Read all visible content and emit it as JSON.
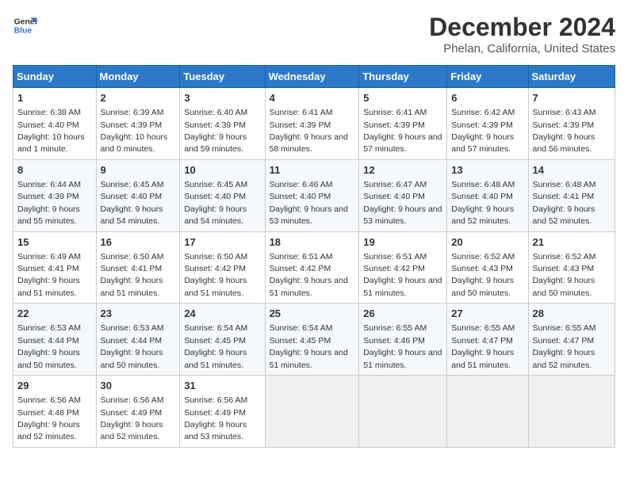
{
  "header": {
    "logo_line1": "General",
    "logo_line2": "Blue",
    "title": "December 2024",
    "subtitle": "Phelan, California, United States"
  },
  "weekdays": [
    "Sunday",
    "Monday",
    "Tuesday",
    "Wednesday",
    "Thursday",
    "Friday",
    "Saturday"
  ],
  "weeks": [
    [
      {
        "day": "1",
        "sunrise": "6:38 AM",
        "sunset": "4:40 PM",
        "daylight": "10 hours and 1 minute."
      },
      {
        "day": "2",
        "sunrise": "6:39 AM",
        "sunset": "4:39 PM",
        "daylight": "10 hours and 0 minutes."
      },
      {
        "day": "3",
        "sunrise": "6:40 AM",
        "sunset": "4:39 PM",
        "daylight": "9 hours and 59 minutes."
      },
      {
        "day": "4",
        "sunrise": "6:41 AM",
        "sunset": "4:39 PM",
        "daylight": "9 hours and 58 minutes."
      },
      {
        "day": "5",
        "sunrise": "6:41 AM",
        "sunset": "4:39 PM",
        "daylight": "9 hours and 57 minutes."
      },
      {
        "day": "6",
        "sunrise": "6:42 AM",
        "sunset": "4:39 PM",
        "daylight": "9 hours and 57 minutes."
      },
      {
        "day": "7",
        "sunrise": "6:43 AM",
        "sunset": "4:39 PM",
        "daylight": "9 hours and 56 minutes."
      }
    ],
    [
      {
        "day": "8",
        "sunrise": "6:44 AM",
        "sunset": "4:39 PM",
        "daylight": "9 hours and 55 minutes."
      },
      {
        "day": "9",
        "sunrise": "6:45 AM",
        "sunset": "4:40 PM",
        "daylight": "9 hours and 54 minutes."
      },
      {
        "day": "10",
        "sunrise": "6:45 AM",
        "sunset": "4:40 PM",
        "daylight": "9 hours and 54 minutes."
      },
      {
        "day": "11",
        "sunrise": "6:46 AM",
        "sunset": "4:40 PM",
        "daylight": "9 hours and 53 minutes."
      },
      {
        "day": "12",
        "sunrise": "6:47 AM",
        "sunset": "4:40 PM",
        "daylight": "9 hours and 53 minutes."
      },
      {
        "day": "13",
        "sunrise": "6:48 AM",
        "sunset": "4:40 PM",
        "daylight": "9 hours and 52 minutes."
      },
      {
        "day": "14",
        "sunrise": "6:48 AM",
        "sunset": "4:41 PM",
        "daylight": "9 hours and 52 minutes."
      }
    ],
    [
      {
        "day": "15",
        "sunrise": "6:49 AM",
        "sunset": "4:41 PM",
        "daylight": "9 hours and 51 minutes."
      },
      {
        "day": "16",
        "sunrise": "6:50 AM",
        "sunset": "4:41 PM",
        "daylight": "9 hours and 51 minutes."
      },
      {
        "day": "17",
        "sunrise": "6:50 AM",
        "sunset": "4:42 PM",
        "daylight": "9 hours and 51 minutes."
      },
      {
        "day": "18",
        "sunrise": "6:51 AM",
        "sunset": "4:42 PM",
        "daylight": "9 hours and 51 minutes."
      },
      {
        "day": "19",
        "sunrise": "6:51 AM",
        "sunset": "4:42 PM",
        "daylight": "9 hours and 51 minutes."
      },
      {
        "day": "20",
        "sunrise": "6:52 AM",
        "sunset": "4:43 PM",
        "daylight": "9 hours and 50 minutes."
      },
      {
        "day": "21",
        "sunrise": "6:52 AM",
        "sunset": "4:43 PM",
        "daylight": "9 hours and 50 minutes."
      }
    ],
    [
      {
        "day": "22",
        "sunrise": "6:53 AM",
        "sunset": "4:44 PM",
        "daylight": "9 hours and 50 minutes."
      },
      {
        "day": "23",
        "sunrise": "6:53 AM",
        "sunset": "4:44 PM",
        "daylight": "9 hours and 50 minutes."
      },
      {
        "day": "24",
        "sunrise": "6:54 AM",
        "sunset": "4:45 PM",
        "daylight": "9 hours and 51 minutes."
      },
      {
        "day": "25",
        "sunrise": "6:54 AM",
        "sunset": "4:45 PM",
        "daylight": "9 hours and 51 minutes."
      },
      {
        "day": "26",
        "sunrise": "6:55 AM",
        "sunset": "4:46 PM",
        "daylight": "9 hours and 51 minutes."
      },
      {
        "day": "27",
        "sunrise": "6:55 AM",
        "sunset": "4:47 PM",
        "daylight": "9 hours and 51 minutes."
      },
      {
        "day": "28",
        "sunrise": "6:55 AM",
        "sunset": "4:47 PM",
        "daylight": "9 hours and 52 minutes."
      }
    ],
    [
      {
        "day": "29",
        "sunrise": "6:56 AM",
        "sunset": "4:48 PM",
        "daylight": "9 hours and 52 minutes."
      },
      {
        "day": "30",
        "sunrise": "6:56 AM",
        "sunset": "4:49 PM",
        "daylight": "9 hours and 52 minutes."
      },
      {
        "day": "31",
        "sunrise": "6:56 AM",
        "sunset": "4:49 PM",
        "daylight": "9 hours and 53 minutes."
      },
      null,
      null,
      null,
      null
    ]
  ],
  "labels": {
    "sunrise": "Sunrise:",
    "sunset": "Sunset:",
    "daylight": "Daylight:"
  }
}
